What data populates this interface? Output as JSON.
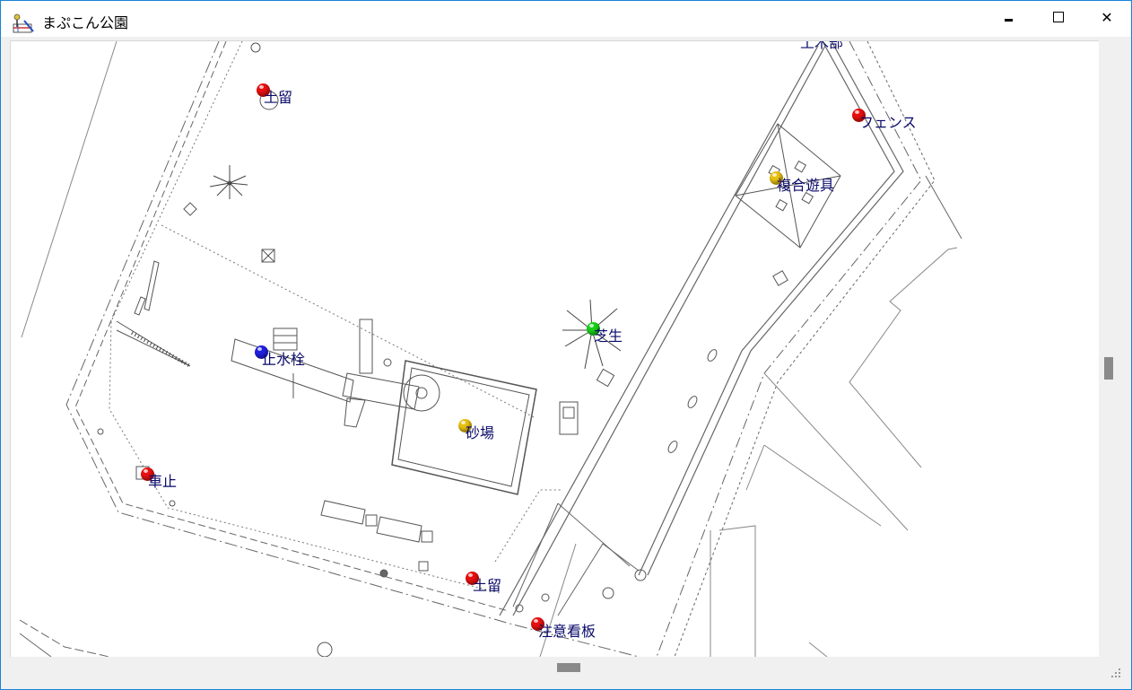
{
  "window": {
    "title": "まぷこん公園",
    "icon": "map-app-icon"
  },
  "controls": {
    "minimize_icon": "minimize-icon",
    "maximize_icon": "maximize-icon",
    "close_icon": "close-icon",
    "close_glyph": "✕"
  },
  "map": {
    "top_edge_text": "土木部",
    "markers": [
      {
        "label": "土留",
        "color": "#e81010"
      },
      {
        "label": "フェンス",
        "color": "#e81010"
      },
      {
        "label": "複合遊具",
        "color": "#e8c010"
      },
      {
        "label": "芝生",
        "color": "#18d018"
      },
      {
        "label": "止水栓",
        "color": "#2020e0"
      },
      {
        "label": "砂場",
        "color": "#e8c010"
      },
      {
        "label": "車止",
        "color": "#e81010"
      },
      {
        "label": "土留",
        "color": "#e81010"
      },
      {
        "label": "注意看板",
        "color": "#e81010"
      }
    ]
  }
}
